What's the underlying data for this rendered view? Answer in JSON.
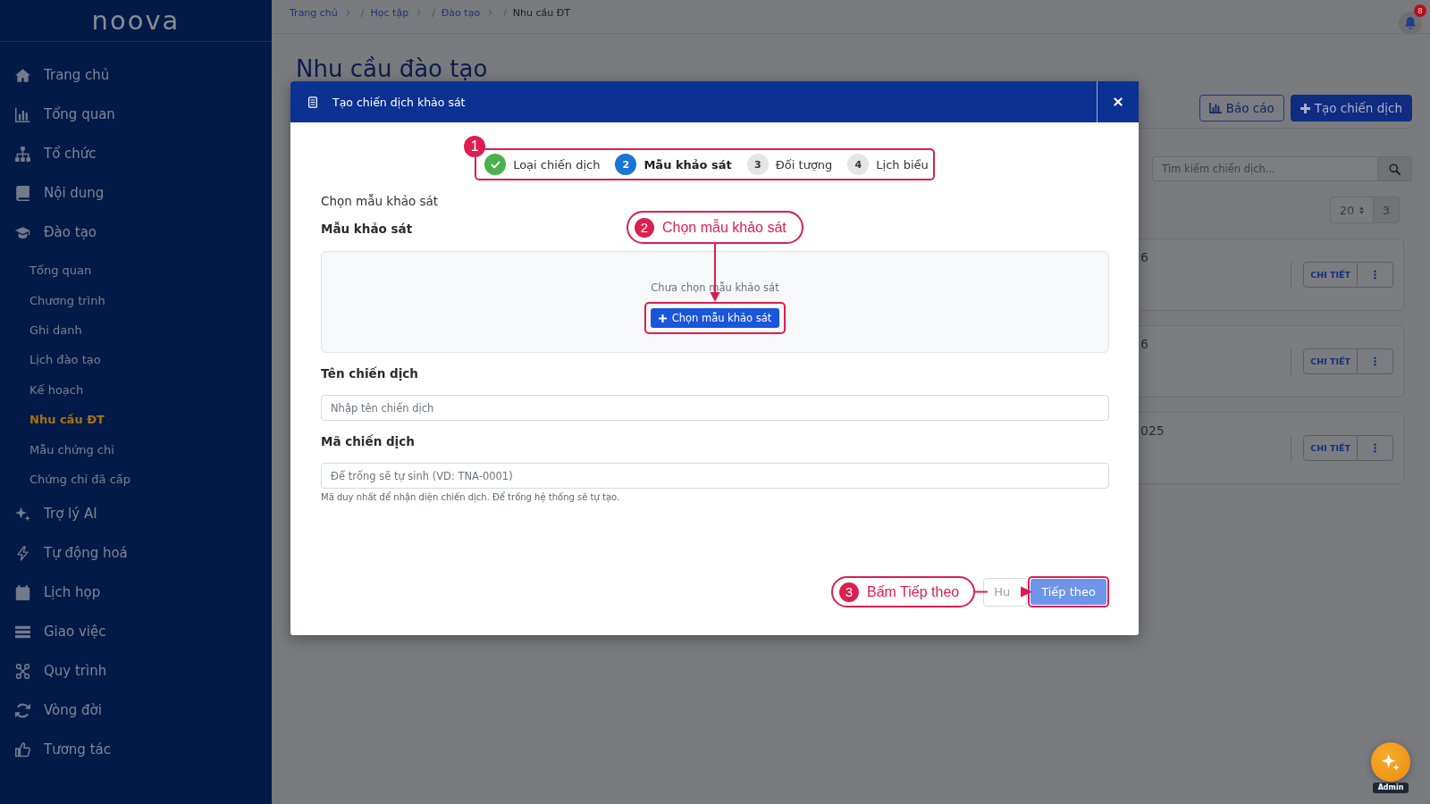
{
  "sidebar": {
    "logo": "noova",
    "items": [
      {
        "label": "Trang chủ",
        "selected": false
      },
      {
        "label": "Tổng quan",
        "selected": false
      },
      {
        "label": "Tổ chức",
        "selected": false
      },
      {
        "label": "Nội dung",
        "selected": false
      },
      {
        "label": "Đào tạo",
        "selected": false,
        "children": [
          {
            "label": "Tổng quan",
            "selected": false
          },
          {
            "label": "Chương trình",
            "selected": false
          },
          {
            "label": "Ghi danh",
            "selected": false
          },
          {
            "label": "Lịch đào tạo",
            "selected": false
          },
          {
            "label": "Kế hoạch",
            "selected": false
          },
          {
            "label": "Nhu cầu ĐT",
            "selected": true
          },
          {
            "label": "Mẫu chứng chỉ",
            "selected": false
          },
          {
            "label": "Chứng chỉ đã cấp",
            "selected": false
          }
        ]
      },
      {
        "label": "Trợ lý AI",
        "selected": false
      },
      {
        "label": "Tự động hoá",
        "selected": false
      },
      {
        "label": "Lịch họp",
        "selected": false
      },
      {
        "label": "Giao việc",
        "selected": false
      },
      {
        "label": "Quy trình",
        "selected": false
      },
      {
        "label": "Vòng đời",
        "selected": false
      },
      {
        "label": "Tương tác",
        "selected": false
      }
    ]
  },
  "breadcrumb": [
    {
      "label": "Trang chủ",
      "current": false
    },
    {
      "divider": "/",
      "label": "Học tập",
      "current": false
    },
    {
      "divider": "/",
      "label": "Đào tạo",
      "current": false
    },
    {
      "divider": "/",
      "label": "Nhu cầu ĐT",
      "current": true
    }
  ],
  "notifications": {
    "badge": "8"
  },
  "page": {
    "title": "Nhu cầu đào tạo",
    "buttons": [
      {
        "label": "Báo cáo",
        "kind": "outline"
      },
      {
        "label": "Tạo chiến dịch",
        "kind": "primary"
      }
    ],
    "search": {
      "placeholder": "Tìm kiếm chiến dịch..."
    },
    "pager": {
      "page_size": "20",
      "count": "3"
    },
    "cards": [
      {
        "text": "6",
        "button": "CHI TIẾT"
      },
      {
        "text": "6",
        "button": "CHI TIẾT"
      },
      {
        "text": "025",
        "button": "CHI TIẾT"
      }
    ]
  },
  "modal": {
    "title": "Tạo chiến dịch khảo sát",
    "steps": [
      {
        "label": "Loại chiến dịch",
        "completed": true,
        "selected": false
      },
      {
        "number": "2",
        "label": "Mẫu khảo sát",
        "completed": false,
        "selected": true
      },
      {
        "number": "3",
        "label": "Đối tượng",
        "completed": false,
        "selected": false
      },
      {
        "number": "4",
        "label": "Lịch biểu",
        "completed": false,
        "selected": false
      }
    ],
    "section_title": "Chọn mẫu khảo sát",
    "template": {
      "label": "Mẫu khảo sát",
      "empty_text": "Chưa chọn mẫu khảo sát",
      "button": "Chọn mẫu khảo sát"
    },
    "fields": [
      {
        "label": "Tên chiến dịch",
        "placeholder": "Nhập tên chiến dịch"
      },
      {
        "label": "Mã chiến dịch",
        "placeholder": "Để trống sẽ tự sinh (VD: TNA-0001)",
        "help": "Mã duy nhất để nhận diện chiến dịch. Để trống hệ thống sẽ tự tạo."
      }
    ],
    "buttons": [
      {
        "label": "Hu",
        "kind": "secondary",
        "disabled": false
      },
      {
        "label": "Tiếp theo",
        "kind": "primary",
        "disabled": true
      }
    ]
  },
  "annotations": [
    {
      "number": "1"
    },
    {
      "number": "2",
      "label": "Chọn mẫu khảo sát"
    },
    {
      "number": "3",
      "label": "Bấm Tiếp theo"
    }
  ],
  "assistant": {
    "label": "Admin"
  }
}
